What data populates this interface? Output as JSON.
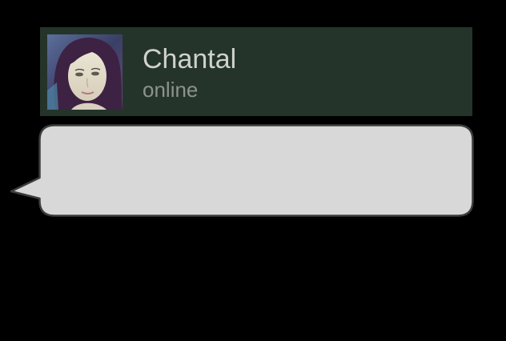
{
  "contact": {
    "name": "Chantal",
    "status": "online"
  },
  "message": {
    "text": ""
  },
  "colors": {
    "background": "#000000",
    "header_background": "#25342b",
    "name_text": "#cfd2cf",
    "status_text": "#8c938d",
    "bubble_fill": "#d8d8d8",
    "bubble_border": "#3c3c3c"
  },
  "icons": {
    "avatar": "user-photo"
  }
}
